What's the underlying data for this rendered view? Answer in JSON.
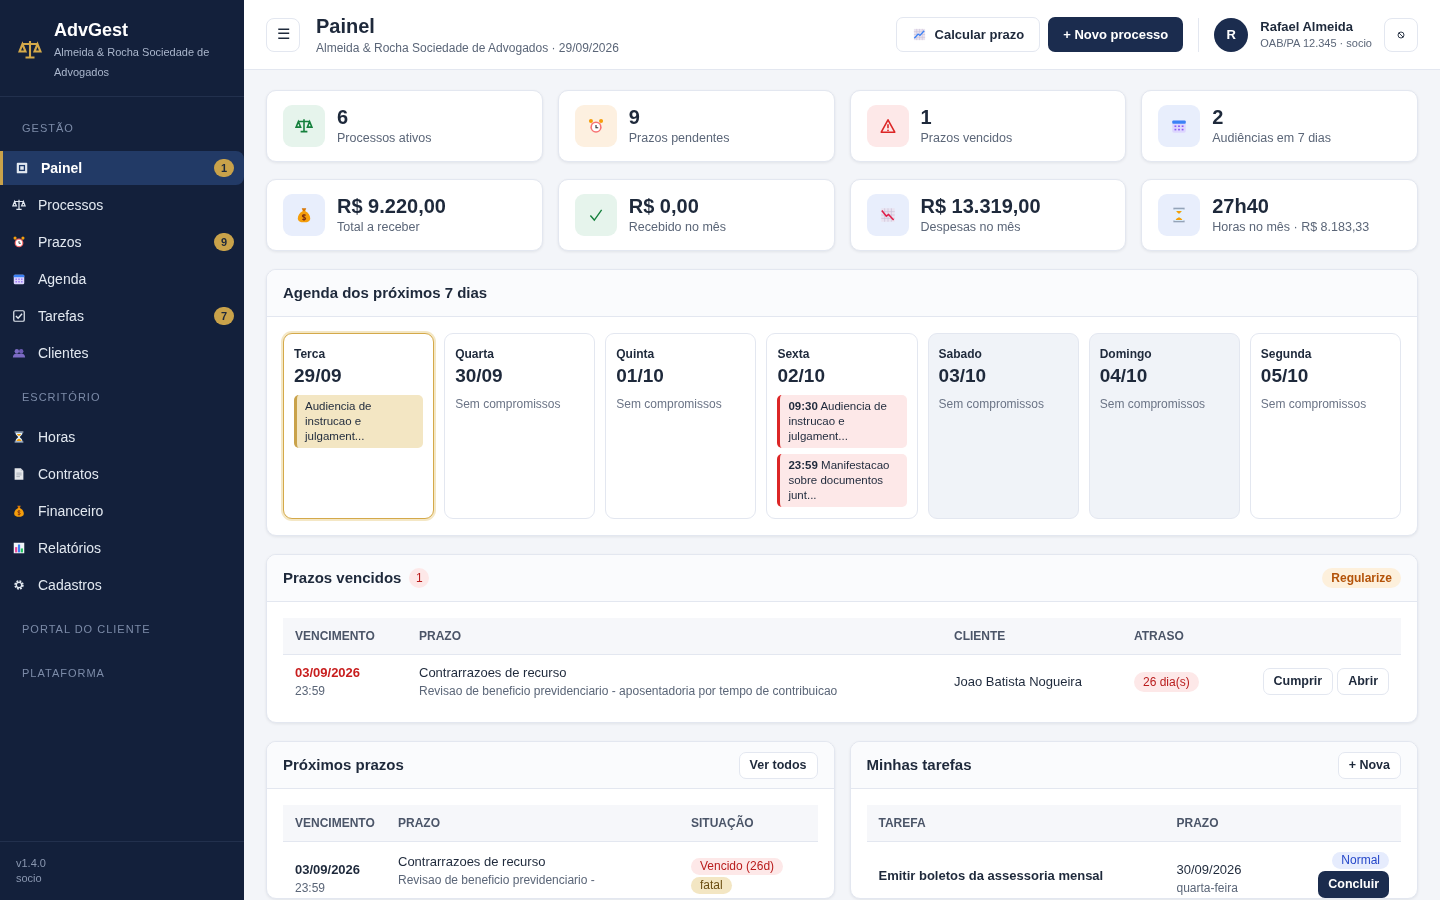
{
  "sidebar": {
    "brand": "AdvGest",
    "subtitle": "Almeida & Rocha Sociedade de Advogados",
    "sections": [
      {
        "title": "GESTÃO",
        "items": [
          {
            "label": "Painel",
            "selected": true,
            "badge": "1"
          },
          {
            "label": "Processos",
            "selected": false
          },
          {
            "label": "Prazos",
            "selected": false,
            "badge": "9"
          },
          {
            "label": "Agenda",
            "selected": false
          },
          {
            "label": "Tarefas",
            "selected": false,
            "badge": "7"
          },
          {
            "label": "Clientes",
            "selected": false
          }
        ]
      },
      {
        "title": "ESCRITÓRIO",
        "items": [
          {
            "label": "Horas",
            "selected": false
          },
          {
            "label": "Contratos",
            "selected": false
          },
          {
            "label": "Financeiro",
            "selected": false
          },
          {
            "label": "Relatórios",
            "selected": false
          },
          {
            "label": "Cadastros",
            "selected": false
          }
        ]
      },
      {
        "title": "PORTAL DO CLIENTE"
      },
      {
        "title": "PLATAFORMA"
      }
    ],
    "footer": [
      "v1.4.0",
      "socio"
    ]
  },
  "header": {
    "menu": "☰",
    "title": "Painel",
    "subtitle": "Almeida & Rocha Sociedade de Advogados · 29/09/2026",
    "buttons": [
      "Calcular prazo",
      "+ Novo processo"
    ],
    "user": {
      "initial": "R",
      "name": "Rafael Almeida",
      "role": "OAB/PA 12.345 · socio"
    }
  },
  "stats": [
    {
      "value": "6",
      "label": "Processos ativos"
    },
    {
      "value": "9",
      "label": "Prazos pendentes"
    },
    {
      "value": "1",
      "label": "Prazos vencidos"
    },
    {
      "value": "2",
      "label": "Audiências em 7 dias"
    },
    {
      "value": "R$ 9.220,00",
      "label": "Total a receber"
    },
    {
      "value": "R$ 0,00",
      "label": "Recebido no mês"
    },
    {
      "value": "R$ 13.319,00",
      "label": "Despesas no mês"
    },
    {
      "value": "27h40",
      "label": "Horas no mês · R$ 8.183,33"
    }
  ],
  "agenda": {
    "title": "Agenda dos próximos 7 dias",
    "days": [
      {
        "weekday": "Terca",
        "date": "29/09",
        "selected": true,
        "weekend": false,
        "events": [
          {
            "text": "Audiencia de instrucao e julgament...",
            "color": "#c9a24a"
          }
        ]
      },
      {
        "weekday": "Quarta",
        "date": "30/09",
        "selected": false,
        "weekend": false,
        "empty": "Sem compromissos"
      },
      {
        "weekday": "Quinta",
        "date": "01/10",
        "selected": false,
        "weekend": false,
        "empty": "Sem compromissos"
      },
      {
        "weekday": "Sexta",
        "date": "02/10",
        "selected": false,
        "weekend": false,
        "events": [
          {
            "time": "09:30",
            "text": "Audiencia de instrucao e julgament...",
            "color": "#dc2626"
          },
          {
            "time": "23:59",
            "text": "Manifestacao sobre documentos junt...",
            "color": "#dc2626"
          }
        ]
      },
      {
        "weekday": "Sabado",
        "date": "03/10",
        "selected": false,
        "weekend": true,
        "empty": "Sem compromissos"
      },
      {
        "weekday": "Domingo",
        "date": "04/10",
        "selected": false,
        "weekend": true,
        "empty": "Sem compromissos"
      },
      {
        "weekday": "Segunda",
        "date": "05/10",
        "selected": false,
        "weekend": false,
        "empty": "Sem compromissos"
      }
    ]
  },
  "overdue": {
    "title": "Prazos vencidos",
    "count": "1",
    "badge": "Regularize",
    "columns": [
      "VENCIMENTO",
      "PRAZO",
      "CLIENTE",
      "ATRASO"
    ],
    "rows": [
      {
        "date": "03/09/2026",
        "time": "23:59",
        "title": "Contrarrazoes de recurso",
        "description": "Revisao de beneficio previdenciario - aposentadoria por tempo de contribuicao",
        "client": "Joao Batista Nogueira",
        "delay": "26 dia(s)",
        "actions": [
          "Cumprir",
          "Abrir"
        ]
      }
    ]
  },
  "upcoming": {
    "title": "Próximos prazos",
    "button": "Ver todos",
    "columns": [
      "VENCIMENTO",
      "PRAZO",
      "SITUAÇÃO"
    ],
    "rows": [
      {
        "date": "03/09/2026",
        "time": "23:59",
        "title": "Contrarrazoes de recurso",
        "description": "Revisao de beneficio previdenciario -",
        "badges": [
          {
            "text": "Vencido (26d)",
            "kind": "danger"
          },
          {
            "text": "fatal",
            "kind": "warning"
          }
        ]
      }
    ]
  },
  "tasks": {
    "title": "Minhas tarefas",
    "button": "+ Nova",
    "columns": [
      "TAREFA",
      "PRAZO"
    ],
    "rows": [
      {
        "title": "Emitir boletos da assessoria mensal",
        "date": "30/09/2026",
        "weekday": "quarta-feira",
        "priority": "Normal",
        "action": "Concluir"
      }
    ]
  }
}
